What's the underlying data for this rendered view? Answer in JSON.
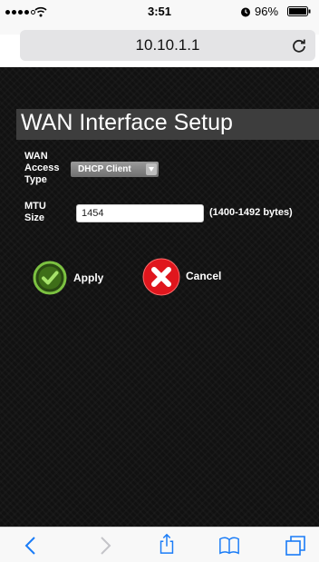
{
  "status_bar": {
    "time": "3:51",
    "battery_percent": "96%"
  },
  "browser": {
    "url": "10.10.1.1"
  },
  "page": {
    "title": "WAN Interface Setup",
    "wan_access_type": {
      "label_lines": [
        "WAN",
        "Access",
        "Type"
      ],
      "selected": "DHCP Client"
    },
    "mtu": {
      "label_lines": [
        "MTU",
        "Size"
      ],
      "value": "1454",
      "range_hint": "(1400-1492 bytes)"
    },
    "buttons": {
      "apply_label": "Apply",
      "cancel_label": "Cancel"
    }
  },
  "colors": {
    "apply_green": "#6aab2c",
    "cancel_red": "#e0161d",
    "ios_blue": "#1a7cf7",
    "title_band": "#3d3d3d"
  },
  "icons": {
    "reload": "reload-icon",
    "back": "chevron-left-icon",
    "forward": "chevron-right-icon",
    "share": "share-icon",
    "bookmarks": "book-icon",
    "tabs": "tabs-icon",
    "apply": "checkmark-circle-icon",
    "cancel": "x-circle-icon"
  }
}
